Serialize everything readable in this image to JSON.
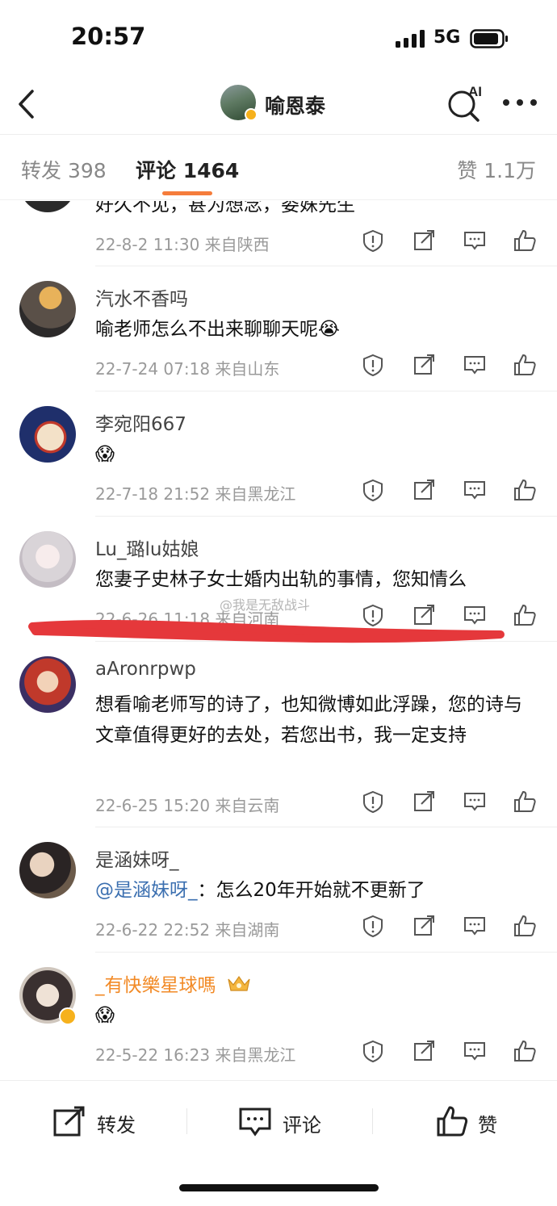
{
  "status_bar": {
    "time": "20:57",
    "network": "5G"
  },
  "header": {
    "title": "喻恩泰",
    "ai_label": "AI"
  },
  "tabs": {
    "repost": "转发 398",
    "comment": "评论 1464",
    "like": "赞 1.1万"
  },
  "comments": [
    {
      "username": "",
      "content": "好久不见，甚为想念，娄姝先生",
      "meta": "22-8-2 11:30  来自陕西"
    },
    {
      "username": "汽水不香吗",
      "content": "喻老师怎么不出来聊聊天呢😭",
      "meta": "22-7-24 07:18  来自山东"
    },
    {
      "username": "李宛阳667",
      "content": "😱",
      "meta": "22-7-18 21:52  来自黑龙江"
    },
    {
      "username": "Lu_璐lu姑娘",
      "content": "您妻子史林子女士婚内出轨的事情，您知情么",
      "meta": "22-6-26 11:18  来自河南"
    },
    {
      "username": "aAronrpwp",
      "content": "想看喻老师写的诗了，也知微博如此浮躁，您的诗与文章值得更好的去处，若您出书，我一定支持",
      "meta": "22-6-25 15:20  来自云南"
    },
    {
      "username": "是涵妹呀_",
      "mention": "@是涵妹呀_",
      "content": "：怎么20年开始就不更新了",
      "meta": "22-6-22 22:52  来自湖南"
    },
    {
      "username": "_有快樂星球嗎",
      "content": "😱",
      "meta": "22-5-22 16:23  来自黑龙江"
    }
  ],
  "watermark": "@我是无敌战斗",
  "bottom_bar": {
    "repost": "转发",
    "comment": "评论",
    "like": "赞"
  },
  "colors": {
    "accent": "#f57c3b",
    "mention": "#3b6fb0",
    "vip_name": "#f28a26",
    "annotation": "#e5383b"
  }
}
